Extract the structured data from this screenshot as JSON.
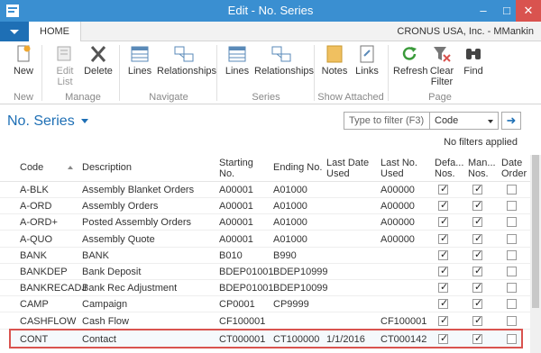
{
  "window": {
    "title": "Edit - No. Series"
  },
  "tabs": {
    "home": "HOME"
  },
  "company": "CRONUS USA, Inc. - MMankin",
  "ribbon": {
    "groups": [
      {
        "label": "New",
        "buttons": [
          {
            "label": "New",
            "icon": "new-document-icon"
          }
        ]
      },
      {
        "label": "Manage",
        "buttons": [
          {
            "label": "Edit List",
            "icon": "edit-list-icon",
            "disabled": true
          },
          {
            "label": "Delete",
            "icon": "delete-icon"
          }
        ]
      },
      {
        "label": "Navigate",
        "buttons": [
          {
            "label": "Lines",
            "icon": "lines-icon"
          },
          {
            "label": "Relationships",
            "icon": "relationships-icon"
          }
        ]
      },
      {
        "label": "Series",
        "buttons": [
          {
            "label": "Lines",
            "icon": "lines-icon"
          },
          {
            "label": "Relationships",
            "icon": "relationships-icon"
          }
        ]
      },
      {
        "label": "Show Attached",
        "buttons": [
          {
            "label": "Notes",
            "icon": "notes-icon"
          },
          {
            "label": "Links",
            "icon": "links-icon"
          }
        ]
      },
      {
        "label": "Page",
        "buttons": [
          {
            "label": "Refresh",
            "icon": "refresh-icon"
          },
          {
            "label": "Clear Filter",
            "icon": "clear-filter-icon"
          },
          {
            "label": "Find",
            "icon": "find-icon"
          }
        ]
      }
    ]
  },
  "page": {
    "title": "No. Series",
    "filter_placeholder": "Type to filter (F3)",
    "filter_field": "Code",
    "no_filters": "No filters applied"
  },
  "grid": {
    "columns": [
      "Code",
      "Description",
      "Starting No.",
      "Ending No.",
      "Last Date Used",
      "Last No. Used",
      "Defa... Nos.",
      "Man... Nos.",
      "Date Order"
    ],
    "rows": [
      {
        "code": "A-BLK",
        "desc": "Assembly Blanket Orders",
        "start": "A00001",
        "end": "A01000",
        "lastdate": "",
        "lastno": "A00000",
        "def": true,
        "man": true,
        "date": false
      },
      {
        "code": "A-ORD",
        "desc": "Assembly Orders",
        "start": "A00001",
        "end": "A01000",
        "lastdate": "",
        "lastno": "A00000",
        "def": true,
        "man": true,
        "date": false
      },
      {
        "code": "A-ORD+",
        "desc": "Posted Assembly Orders",
        "start": "A00001",
        "end": "A01000",
        "lastdate": "",
        "lastno": "A00000",
        "def": true,
        "man": true,
        "date": false
      },
      {
        "code": "A-QUO",
        "desc": "Assembly Quote",
        "start": "A00001",
        "end": "A01000",
        "lastdate": "",
        "lastno": "A00000",
        "def": true,
        "man": true,
        "date": false
      },
      {
        "code": "BANK",
        "desc": "BANK",
        "start": "B010",
        "end": "B990",
        "lastdate": "",
        "lastno": "",
        "def": true,
        "man": true,
        "date": false
      },
      {
        "code": "BANKDEP",
        "desc": "Bank Deposit",
        "start": "BDEP01001",
        "end": "BDEP10999",
        "lastdate": "",
        "lastno": "",
        "def": true,
        "man": true,
        "date": false
      },
      {
        "code": "BANKRECADJ",
        "desc": "Bank Rec Adjustment",
        "start": "BDEP01001",
        "end": "BDEP10099",
        "lastdate": "",
        "lastno": "",
        "def": true,
        "man": true,
        "date": false
      },
      {
        "code": "CAMP",
        "desc": "Campaign",
        "start": "CP0001",
        "end": "CP9999",
        "lastdate": "",
        "lastno": "",
        "def": true,
        "man": true,
        "date": false
      },
      {
        "code": "CASHFLOW",
        "desc": "Cash Flow",
        "start": "CF100001",
        "end": "",
        "lastdate": "",
        "lastno": "CF100001",
        "def": true,
        "man": true,
        "date": false
      },
      {
        "code": "CONT",
        "desc": "Contact",
        "start": "CT000001",
        "end": "CT100000",
        "lastdate": "1/1/2016",
        "lastno": "CT000142",
        "def": true,
        "man": true,
        "date": false
      }
    ]
  },
  "colors": {
    "titlebar": "#3a8fd1",
    "accent": "#1e6fb5",
    "selection_border": "#d9534f"
  }
}
